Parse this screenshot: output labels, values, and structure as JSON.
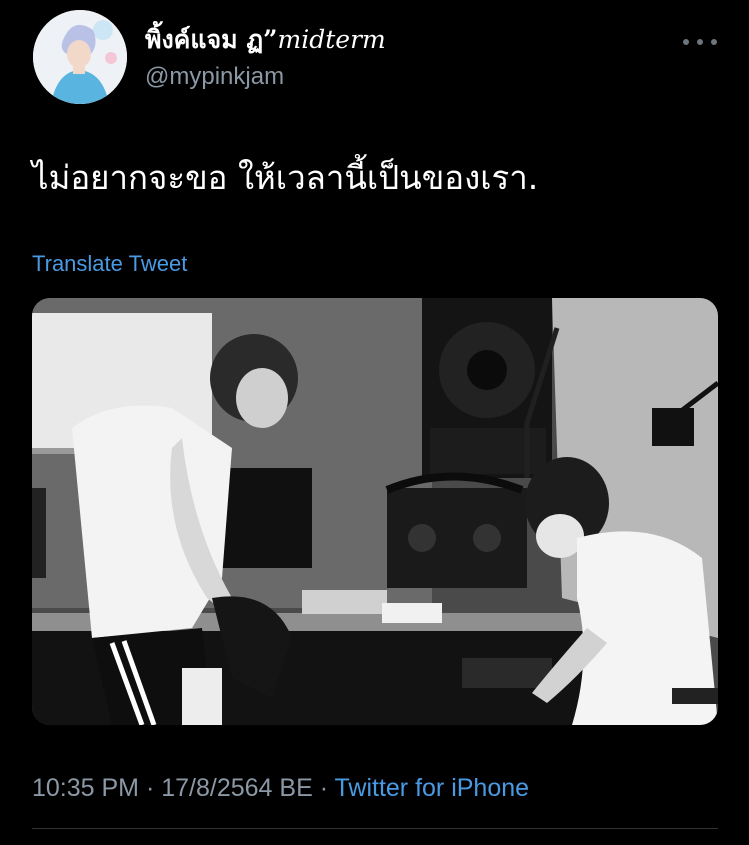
{
  "user": {
    "display_name": "พิ้งค์แจม ฏ”",
    "display_name_suffix": "midterm",
    "handle": "@mypinkjam",
    "avatar_icon": "profile-avatar"
  },
  "more_menu_icon": "more-dots-icon",
  "tweet": {
    "text": "ไม่อยากจะขอ ให้เวลานี้เป็นของเรา.",
    "translate_label": "Translate Tweet",
    "media_type": "photo"
  },
  "meta": {
    "time": "10:35 PM",
    "separator1": " · ",
    "date": "17/8/2564 BE",
    "separator2": " · ",
    "source": "Twitter for iPhone"
  },
  "colors": {
    "background": "#000000",
    "link": "#4a9ae3",
    "secondary_text": "#8b98a5",
    "primary_text": "#ffffff"
  }
}
